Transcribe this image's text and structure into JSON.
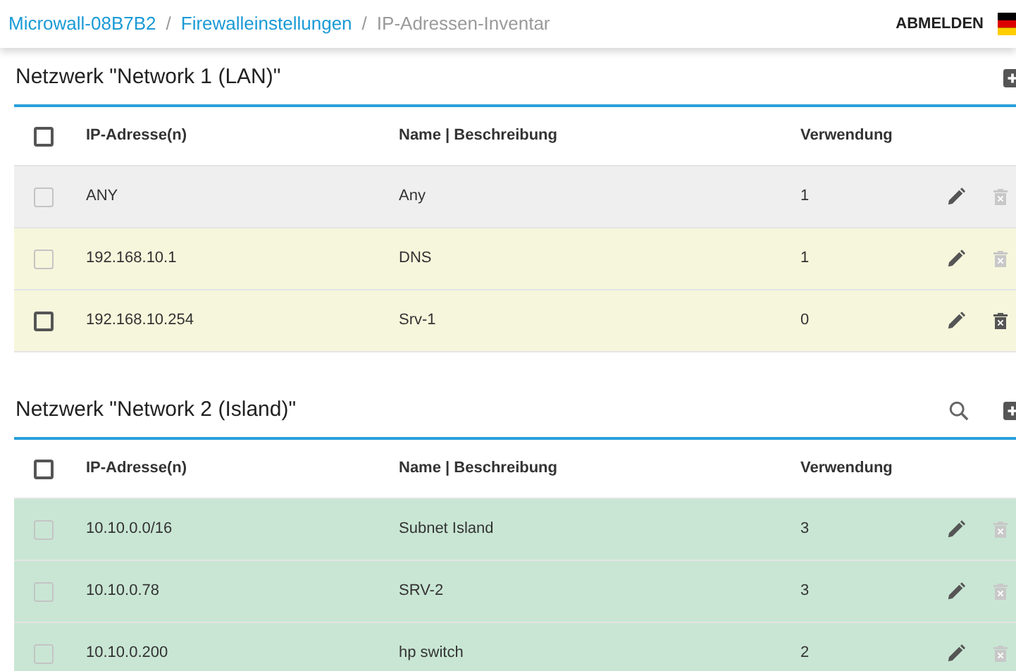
{
  "breadcrumb": [
    {
      "label": "Microwall-08B7B2",
      "current": false
    },
    {
      "label": "Firewalleinstellungen",
      "current": false
    },
    {
      "label": "IP-Adressen-Inventar",
      "current": true
    }
  ],
  "breadcrumb_separator": "/",
  "logout": "ABMELDEN",
  "networks": [
    {
      "title": "Netzwerk \"Network 1 (LAN)\"",
      "search": false,
      "select_all_checked": false,
      "columns": [
        "IP-Adresse(n)",
        "Name | Beschreibung",
        "Verwendung"
      ],
      "rows": [
        {
          "ip": "ANY",
          "name": "Any",
          "usage": "1",
          "checked": false,
          "disabled": true,
          "color": "#efefef"
        },
        {
          "ip": "192.168.10.1",
          "name": "DNS",
          "usage": "1",
          "checked": false,
          "disabled": true,
          "color": "#f6f6dc"
        },
        {
          "ip": "192.168.10.254",
          "name": "Srv-1",
          "usage": "0",
          "checked": false,
          "disabled": false,
          "color": "#f6f6dc"
        }
      ]
    },
    {
      "title": "Netzwerk \"Network 2 (Island)\"",
      "search": true,
      "select_all_checked": false,
      "columns": [
        "IP-Adresse(n)",
        "Name | Beschreibung",
        "Verwendung"
      ],
      "rows": [
        {
          "ip": "10.10.0.0/16",
          "name": "Subnet Island",
          "usage": "3",
          "checked": false,
          "disabled": true,
          "color": "#c9e6d4"
        },
        {
          "ip": "10.10.0.78",
          "name": "SRV-2",
          "usage": "3",
          "checked": false,
          "disabled": true,
          "color": "#c9e6d4"
        },
        {
          "ip": "10.10.0.200",
          "name": "hp switch",
          "usage": "2",
          "checked": false,
          "disabled": true,
          "color": "#c9e6d4"
        }
      ]
    }
  ]
}
